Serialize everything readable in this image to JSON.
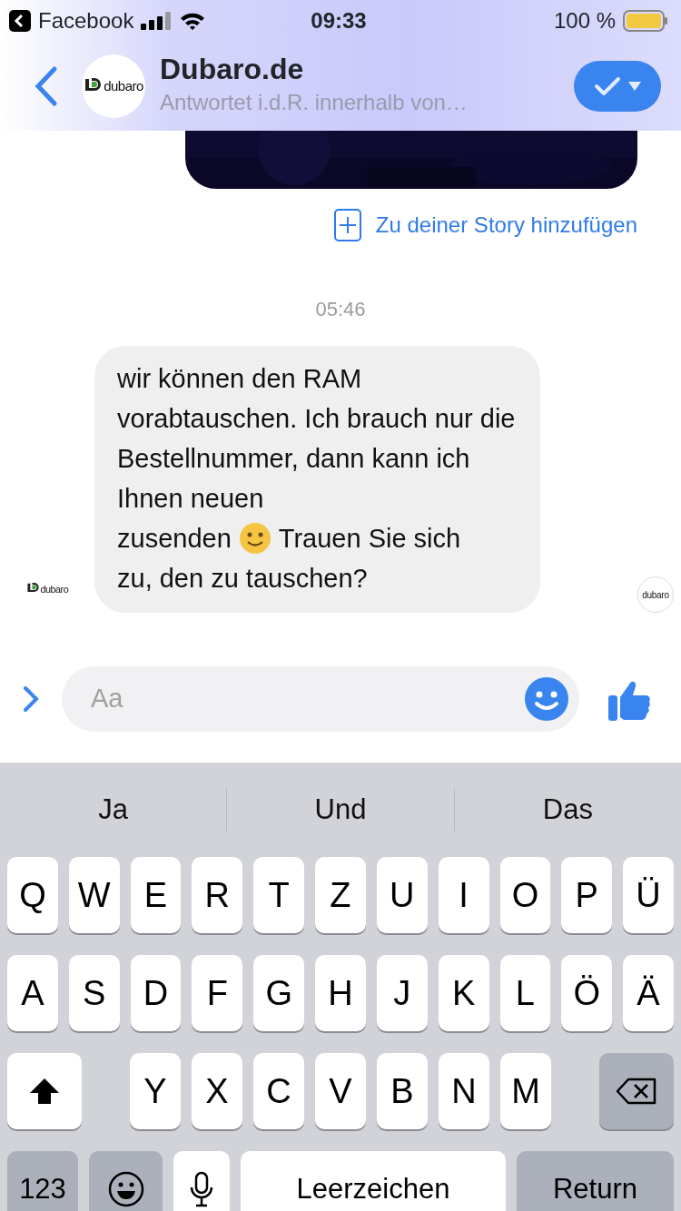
{
  "status_bar": {
    "back_app": "Facebook",
    "time": "09:33",
    "battery_text": "100 %"
  },
  "header": {
    "avatar_logo": "dubaro",
    "title": "Dubaro.de",
    "subtitle": "Antwortet i.d.R. innerhalb von…"
  },
  "chat": {
    "story_link": "Zu deiner Story hinzufügen",
    "timestamp": "05:46",
    "message": {
      "avatar_logo": "dubaro",
      "text_opening": "wir können den RAM vorabtauschen. Ich brauch nur die Bestellnummer, dann kann ich Ihnen neuen",
      "text_before_emoji": "zusenden",
      "text_after_emoji": "Trauen Sie sich",
      "text_closing": "zu, den zu tauschen?",
      "seen_logo": "dubaro"
    }
  },
  "composer": {
    "placeholder": "Aa"
  },
  "keyboard": {
    "suggestions": [
      "Ja",
      "Und",
      "Das"
    ],
    "rows": [
      [
        {
          "kind": "letter",
          "label": "Q"
        },
        {
          "kind": "letter",
          "label": "W"
        },
        {
          "kind": "letter",
          "label": "E"
        },
        {
          "kind": "letter",
          "label": "R"
        },
        {
          "kind": "letter",
          "label": "T"
        },
        {
          "kind": "letter",
          "label": "Z"
        },
        {
          "kind": "letter",
          "label": "U"
        },
        {
          "kind": "letter",
          "label": "I"
        },
        {
          "kind": "letter",
          "label": "O"
        },
        {
          "kind": "letter",
          "label": "P"
        },
        {
          "kind": "letter",
          "label": "Ü"
        }
      ],
      [
        {
          "kind": "letter",
          "label": "A"
        },
        {
          "kind": "letter",
          "label": "S"
        },
        {
          "kind": "letter",
          "label": "D"
        },
        {
          "kind": "letter",
          "label": "F"
        },
        {
          "kind": "letter",
          "label": "G"
        },
        {
          "kind": "letter",
          "label": "H"
        },
        {
          "kind": "letter",
          "label": "J"
        },
        {
          "kind": "letter",
          "label": "K"
        },
        {
          "kind": "letter",
          "label": "L"
        },
        {
          "kind": "letter",
          "label": "Ö"
        },
        {
          "kind": "letter",
          "label": "Ä"
        }
      ],
      [
        {
          "kind": "shift"
        },
        {
          "kind": "gap"
        },
        {
          "kind": "letter",
          "label": "Y"
        },
        {
          "kind": "letter",
          "label": "X"
        },
        {
          "kind": "letter",
          "label": "C"
        },
        {
          "kind": "letter",
          "label": "V"
        },
        {
          "kind": "letter",
          "label": "B"
        },
        {
          "kind": "letter",
          "label": "N"
        },
        {
          "kind": "letter",
          "label": "M"
        },
        {
          "kind": "backspace"
        }
      ]
    ],
    "bottom_row": [
      {
        "kind": "numbers",
        "label": "123"
      },
      {
        "kind": "emoji"
      },
      {
        "kind": "mic"
      },
      {
        "kind": "space",
        "label": "Leerzeichen"
      },
      {
        "kind": "return",
        "label": "Return"
      }
    ]
  }
}
